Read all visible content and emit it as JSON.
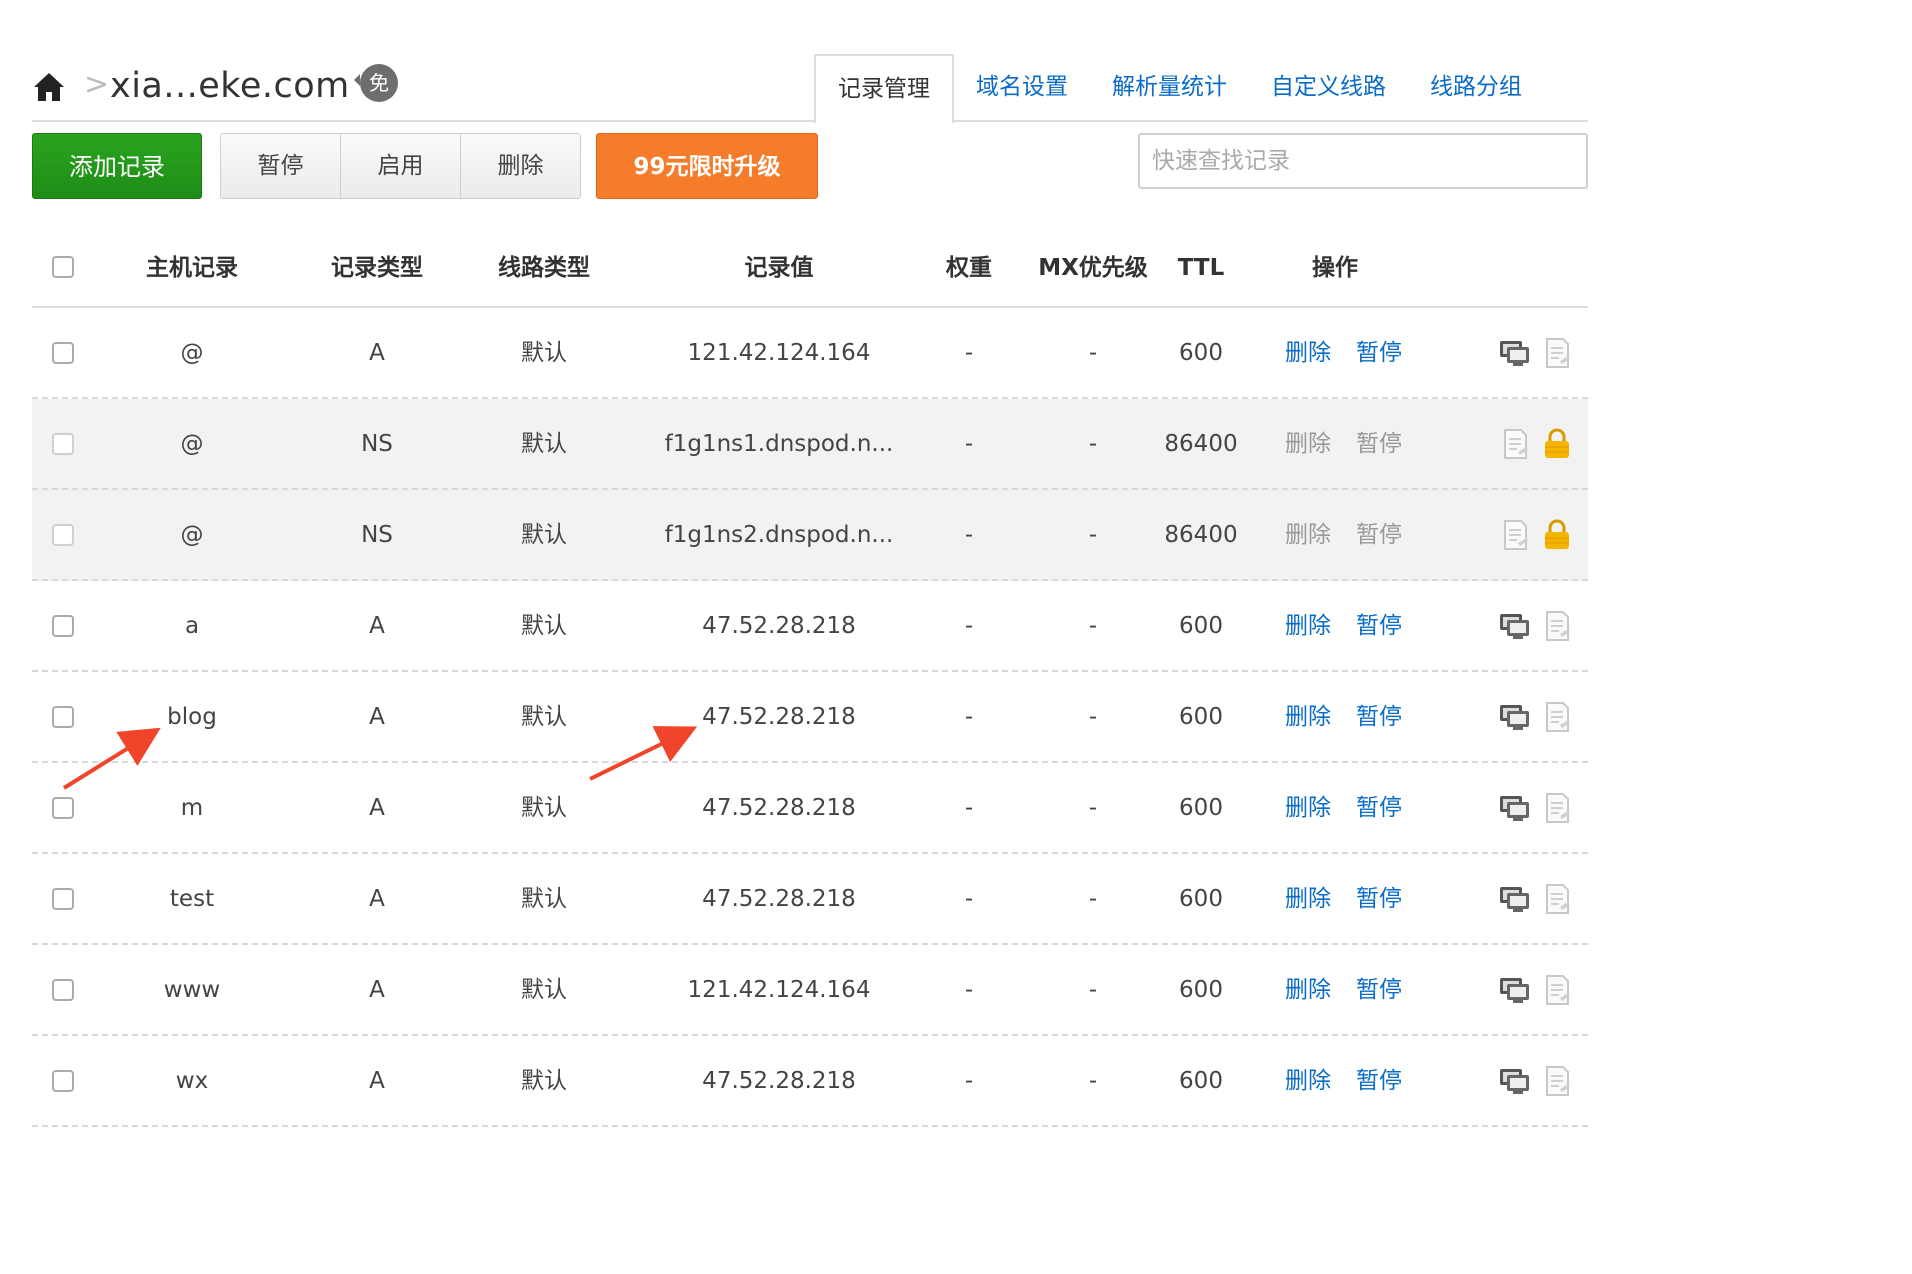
{
  "header": {
    "home_icon": "home-icon",
    "separator": ">",
    "domain": "xia...eke.com",
    "free_badge": "免"
  },
  "tabs": [
    {
      "label": "记录管理",
      "active": true
    },
    {
      "label": "域名设置",
      "active": false
    },
    {
      "label": "解析量统计",
      "active": false
    },
    {
      "label": "自定义线路",
      "active": false
    },
    {
      "label": "线路分组",
      "active": false
    }
  ],
  "toolbar": {
    "add_label": "添加记录",
    "pause_label": "暂停",
    "enable_label": "启用",
    "delete_label": "删除",
    "upgrade_label": "99元限时升级",
    "search_placeholder": "快速查找记录"
  },
  "table": {
    "columns": {
      "host": "主机记录",
      "type": "记录类型",
      "line": "线路类型",
      "value": "记录值",
      "weight": "权重",
      "mx": "MX优先级",
      "ttl": "TTL",
      "actions": "操作"
    },
    "rows": [
      {
        "host": "@",
        "type": "A",
        "line": "默认",
        "value": "121.42.124.164",
        "weight": "-",
        "mx": "-",
        "ttl": "600",
        "del": "删除",
        "pause": "暂停",
        "locked": false
      },
      {
        "host": "@",
        "type": "NS",
        "line": "默认",
        "value": "f1g1ns1.dnspod.n...",
        "weight": "-",
        "mx": "-",
        "ttl": "86400",
        "del": "删除",
        "pause": "暂停",
        "locked": true
      },
      {
        "host": "@",
        "type": "NS",
        "line": "默认",
        "value": "f1g1ns2.dnspod.n...",
        "weight": "-",
        "mx": "-",
        "ttl": "86400",
        "del": "删除",
        "pause": "暂停",
        "locked": true
      },
      {
        "host": "a",
        "type": "A",
        "line": "默认",
        "value": "47.52.28.218",
        "weight": "-",
        "mx": "-",
        "ttl": "600",
        "del": "删除",
        "pause": "暂停",
        "locked": false
      },
      {
        "host": "blog",
        "type": "A",
        "line": "默认",
        "value": "47.52.28.218",
        "weight": "-",
        "mx": "-",
        "ttl": "600",
        "del": "删除",
        "pause": "暂停",
        "locked": false
      },
      {
        "host": "m",
        "type": "A",
        "line": "默认",
        "value": "47.52.28.218",
        "weight": "-",
        "mx": "-",
        "ttl": "600",
        "del": "删除",
        "pause": "暂停",
        "locked": false
      },
      {
        "host": "test",
        "type": "A",
        "line": "默认",
        "value": "47.52.28.218",
        "weight": "-",
        "mx": "-",
        "ttl": "600",
        "del": "删除",
        "pause": "暂停",
        "locked": false
      },
      {
        "host": "www",
        "type": "A",
        "line": "默认",
        "value": "121.42.124.164",
        "weight": "-",
        "mx": "-",
        "ttl": "600",
        "del": "删除",
        "pause": "暂停",
        "locked": false
      },
      {
        "host": "wx",
        "type": "A",
        "line": "默认",
        "value": "47.52.28.218",
        "weight": "-",
        "mx": "-",
        "ttl": "600",
        "del": "删除",
        "pause": "暂停",
        "locked": false
      }
    ]
  },
  "colors": {
    "link": "#0a6cc8",
    "add_button": "#1f8d17",
    "upgrade_button": "#f47c2a",
    "annotation_arrow": "#f0452a",
    "lock_icon": "#f5b400"
  }
}
